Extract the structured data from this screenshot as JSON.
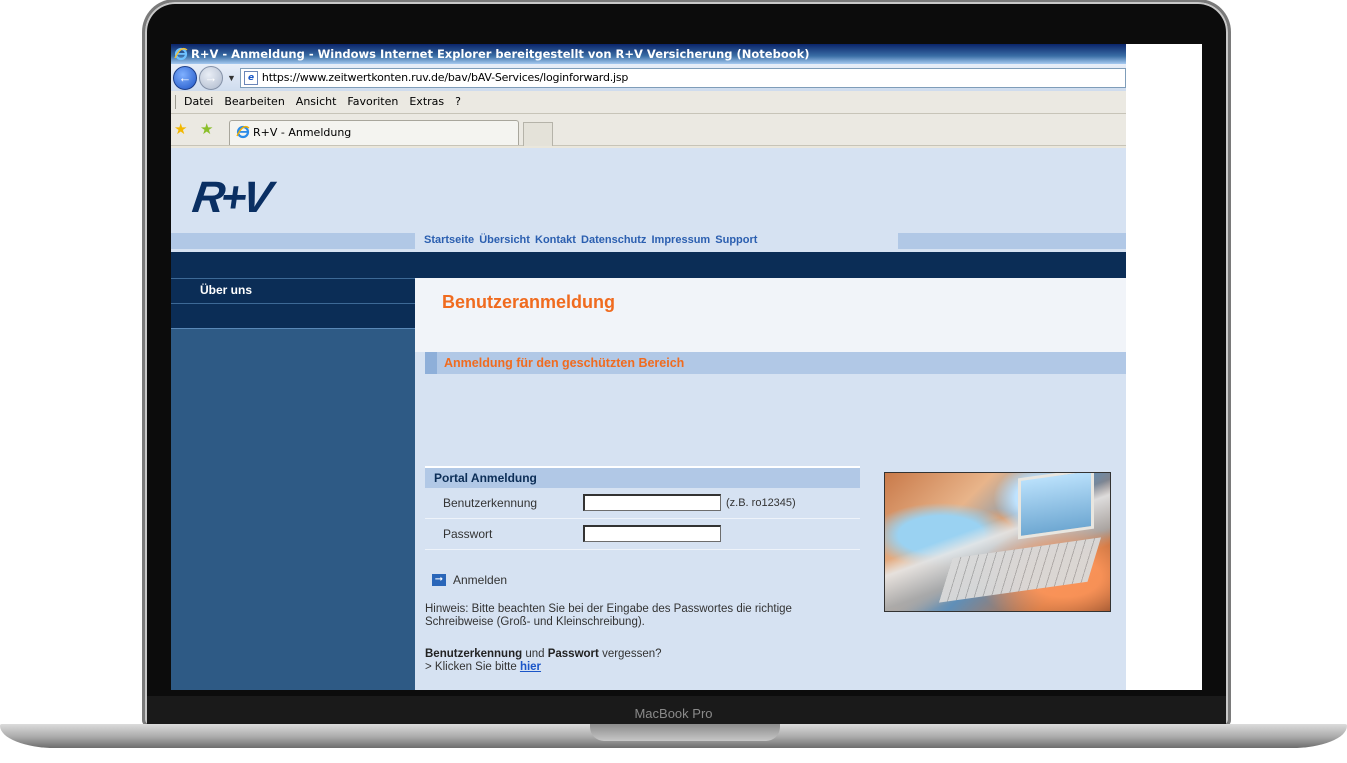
{
  "device": {
    "brand": "MacBook Pro"
  },
  "browser": {
    "window_title": "R+V - Anmeldung - Windows Internet Explorer bereitgestellt von R+V Versicherung (Notebook)",
    "address": "https://www.zeitwertkonten.ruv.de/bav/bAV-Services/loginforward.jsp",
    "menu": [
      "Datei",
      "Bearbeiten",
      "Ansicht",
      "Favoriten",
      "Extras",
      "?"
    ],
    "tab_title": "R+V - Anmeldung"
  },
  "site": {
    "logo": "R+V",
    "top_nav": [
      "Startseite",
      "Übersicht",
      "Kontakt",
      "Datenschutz",
      "Impressum",
      "Support"
    ],
    "sidebar": {
      "heading": "Über uns"
    }
  },
  "login": {
    "page_title": "Benutzeranmeldung",
    "section_title": "Anmeldung für den geschützten Bereich",
    "portal_heading": "Portal Anmeldung",
    "username_label": "Benutzerkennung",
    "username_value": "",
    "username_hint": "(z.B. ro12345)",
    "password_label": "Passwort",
    "password_value": "",
    "submit_label": "Anmelden",
    "note": "Hinweis: Bitte beachten Sie bei der Eingabe des Passwortes die richtige Schreibweise (Groß- und Kleinschreibung).",
    "forgot_user": "Benutzerkennung",
    "forgot_and": "und",
    "forgot_pass": "Passwort",
    "forgot_suffix": "vergessen?",
    "click_prefix": "> Klicken Sie bitte",
    "click_link": "hier"
  },
  "colors": {
    "accent": "#f06b1f",
    "navy": "#0b2d56",
    "light_blue": "#d6e2f2",
    "link": "#2b5fb0"
  }
}
